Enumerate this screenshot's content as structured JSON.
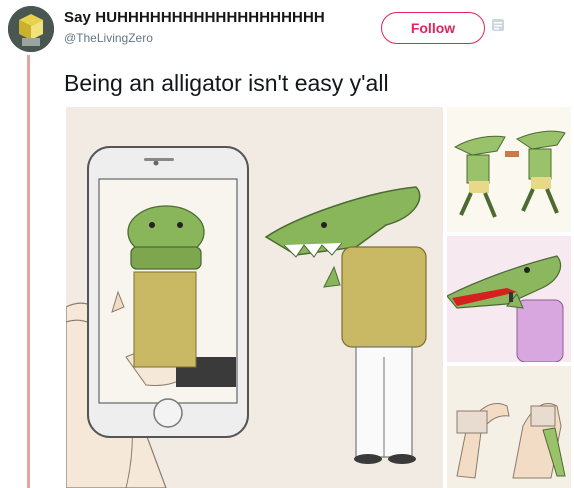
{
  "tweet": {
    "display_name": "Say HUHHHHHHHHHHHHHHHHHHH",
    "handle": "@TheLivingZero",
    "follow_label": "Follow",
    "text": "Being an alligator isn't easy y'all"
  },
  "icons": {
    "avatar": "avatar-image",
    "more": "more-options-icon"
  },
  "media": {
    "images": [
      "alligator-selfie-illustration",
      "alligators-running-illustration",
      "alligator-lipstick-illustration",
      "alligator-stretching-illustration"
    ]
  },
  "colors": {
    "follow_accent": "#e0245e",
    "thread_line": "#e6a5a3",
    "text": "#14171a",
    "muted": "#657786"
  }
}
